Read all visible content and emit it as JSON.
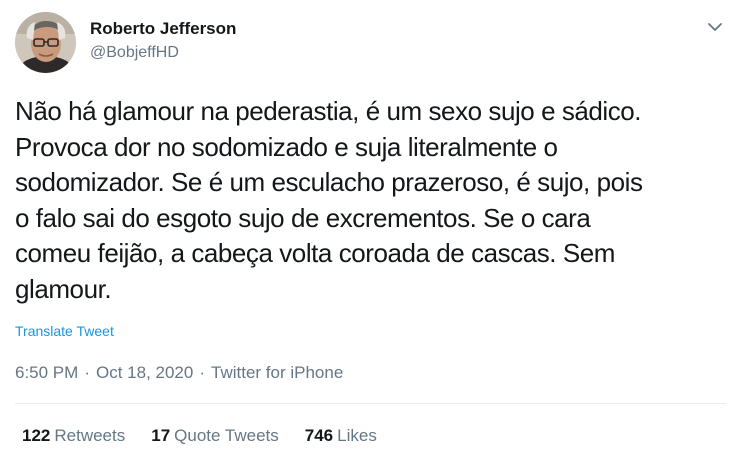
{
  "colors": {
    "text_primary": "#14171a",
    "text_secondary": "#657786",
    "link": "#1b95e0",
    "divider": "#e6ecf0"
  },
  "author": {
    "name": "Roberto Jefferson",
    "handle": "@BobjeffHD",
    "avatar_icon": "user-photo"
  },
  "menu": {
    "icon": "chevron-down-icon"
  },
  "tweet": {
    "lines": [
      "Não há glamour na pederastia, é um sexo sujo e sádico.",
      "Provoca dor no sodomizado e suja literalmente o",
      "sodomizador. Se é um esculacho prazeroso, é sujo, pois",
      "o falo sai do esgoto sujo de excrementos. Se o cara",
      "comeu feijão, a cabeça volta coroada de cascas. Sem",
      "glamour."
    ],
    "translate_label": "Translate Tweet"
  },
  "meta": {
    "time": "6:50 PM",
    "separator": "·",
    "date": "Oct 18, 2020",
    "source": "Twitter for iPhone"
  },
  "stats": [
    {
      "count": "122",
      "label": "Retweets"
    },
    {
      "count": "17",
      "label": "Quote Tweets"
    },
    {
      "count": "746",
      "label": "Likes"
    }
  ]
}
